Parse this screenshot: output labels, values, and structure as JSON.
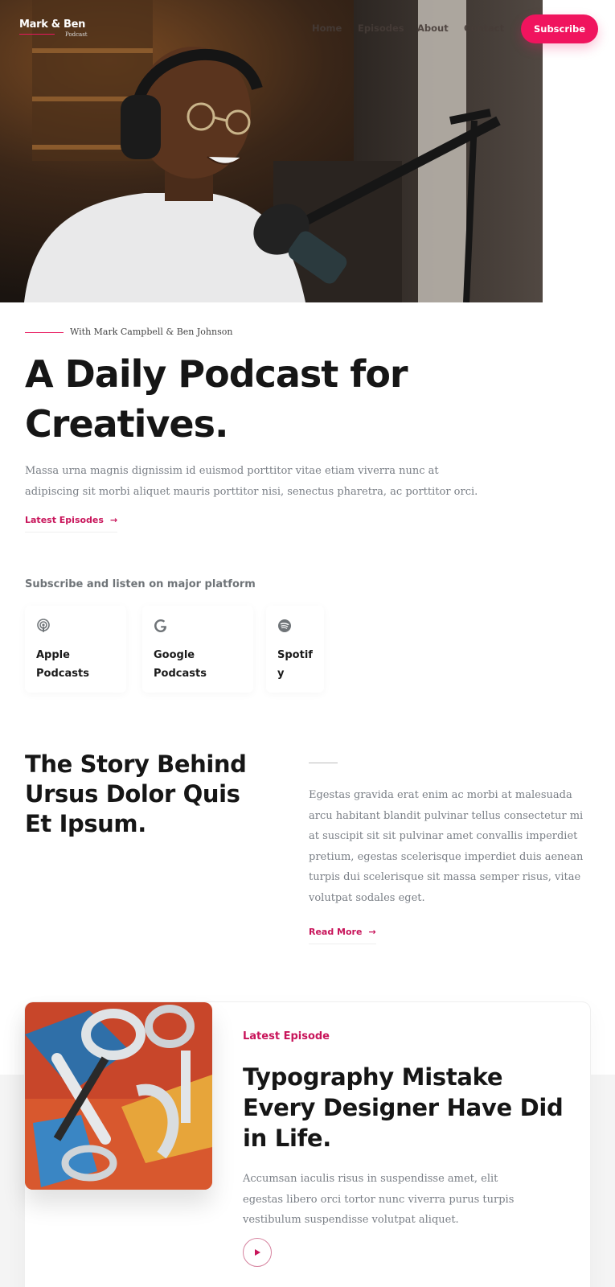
{
  "header": {
    "logo_main": "Mark & Ben",
    "logo_sub": "Podcast",
    "nav": [
      "Home",
      "Episodes",
      "About",
      "Contact"
    ],
    "subscribe_label": "Subscribe"
  },
  "intro": {
    "eyebrow": "With Mark Campbell & Ben Johnson",
    "title_line1": "A Daily Podcast for",
    "title_line2": "Creatives.",
    "lead": "Massa urna magnis dignissim id euismod porttitor vitae etiam viverra nunc at adipiscing sit morbi aliquet mauris porttitor nisi, senectus pharetra, ac porttitor orci.",
    "cta": "Latest Episodes",
    "cta_arrow": "→"
  },
  "platforms": {
    "title": "Subscribe and listen on major platform",
    "items": [
      {
        "icon": "podcast-icon",
        "line1": "Apple",
        "line2": "Podcasts"
      },
      {
        "icon": "google-icon",
        "line1": "Google",
        "line2": "Podcasts"
      },
      {
        "icon": "spotify-icon",
        "line1": "Spotif",
        "line2": "y"
      }
    ]
  },
  "story": {
    "title_line1": "The Story Behind",
    "title_line2": "Ursus Dolor Quis",
    "title_line3": "Et Ipsum.",
    "text": "Egestas gravida erat enim ac morbi at malesuada arcu habitant blandit pulvinar tellus consectetur mi at suscipit sit sit pulvinar amet convallis imperdiet pretium, egestas scelerisque imperdiet duis aenean turpis dui scelerisque sit massa semper risus, vitae volutpat sodales eget.",
    "cta": "Read More",
    "cta_arrow": "→"
  },
  "episode": {
    "eyebrow": "Latest Episode",
    "title_line1": "Typography Mistake",
    "title_line2": "Every Designer Have Did",
    "title_line3": "in Life.",
    "text": "Accumsan iaculis risus in suspendisse amet, elit egestas libero orci tortor nunc viverra purus turpis vestibulum suspendisse volutpat aliquet."
  },
  "colors": {
    "accent": "#f0145e",
    "accent_text": "#c8145a",
    "heading": "#161616",
    "body": "#7a7f86"
  }
}
